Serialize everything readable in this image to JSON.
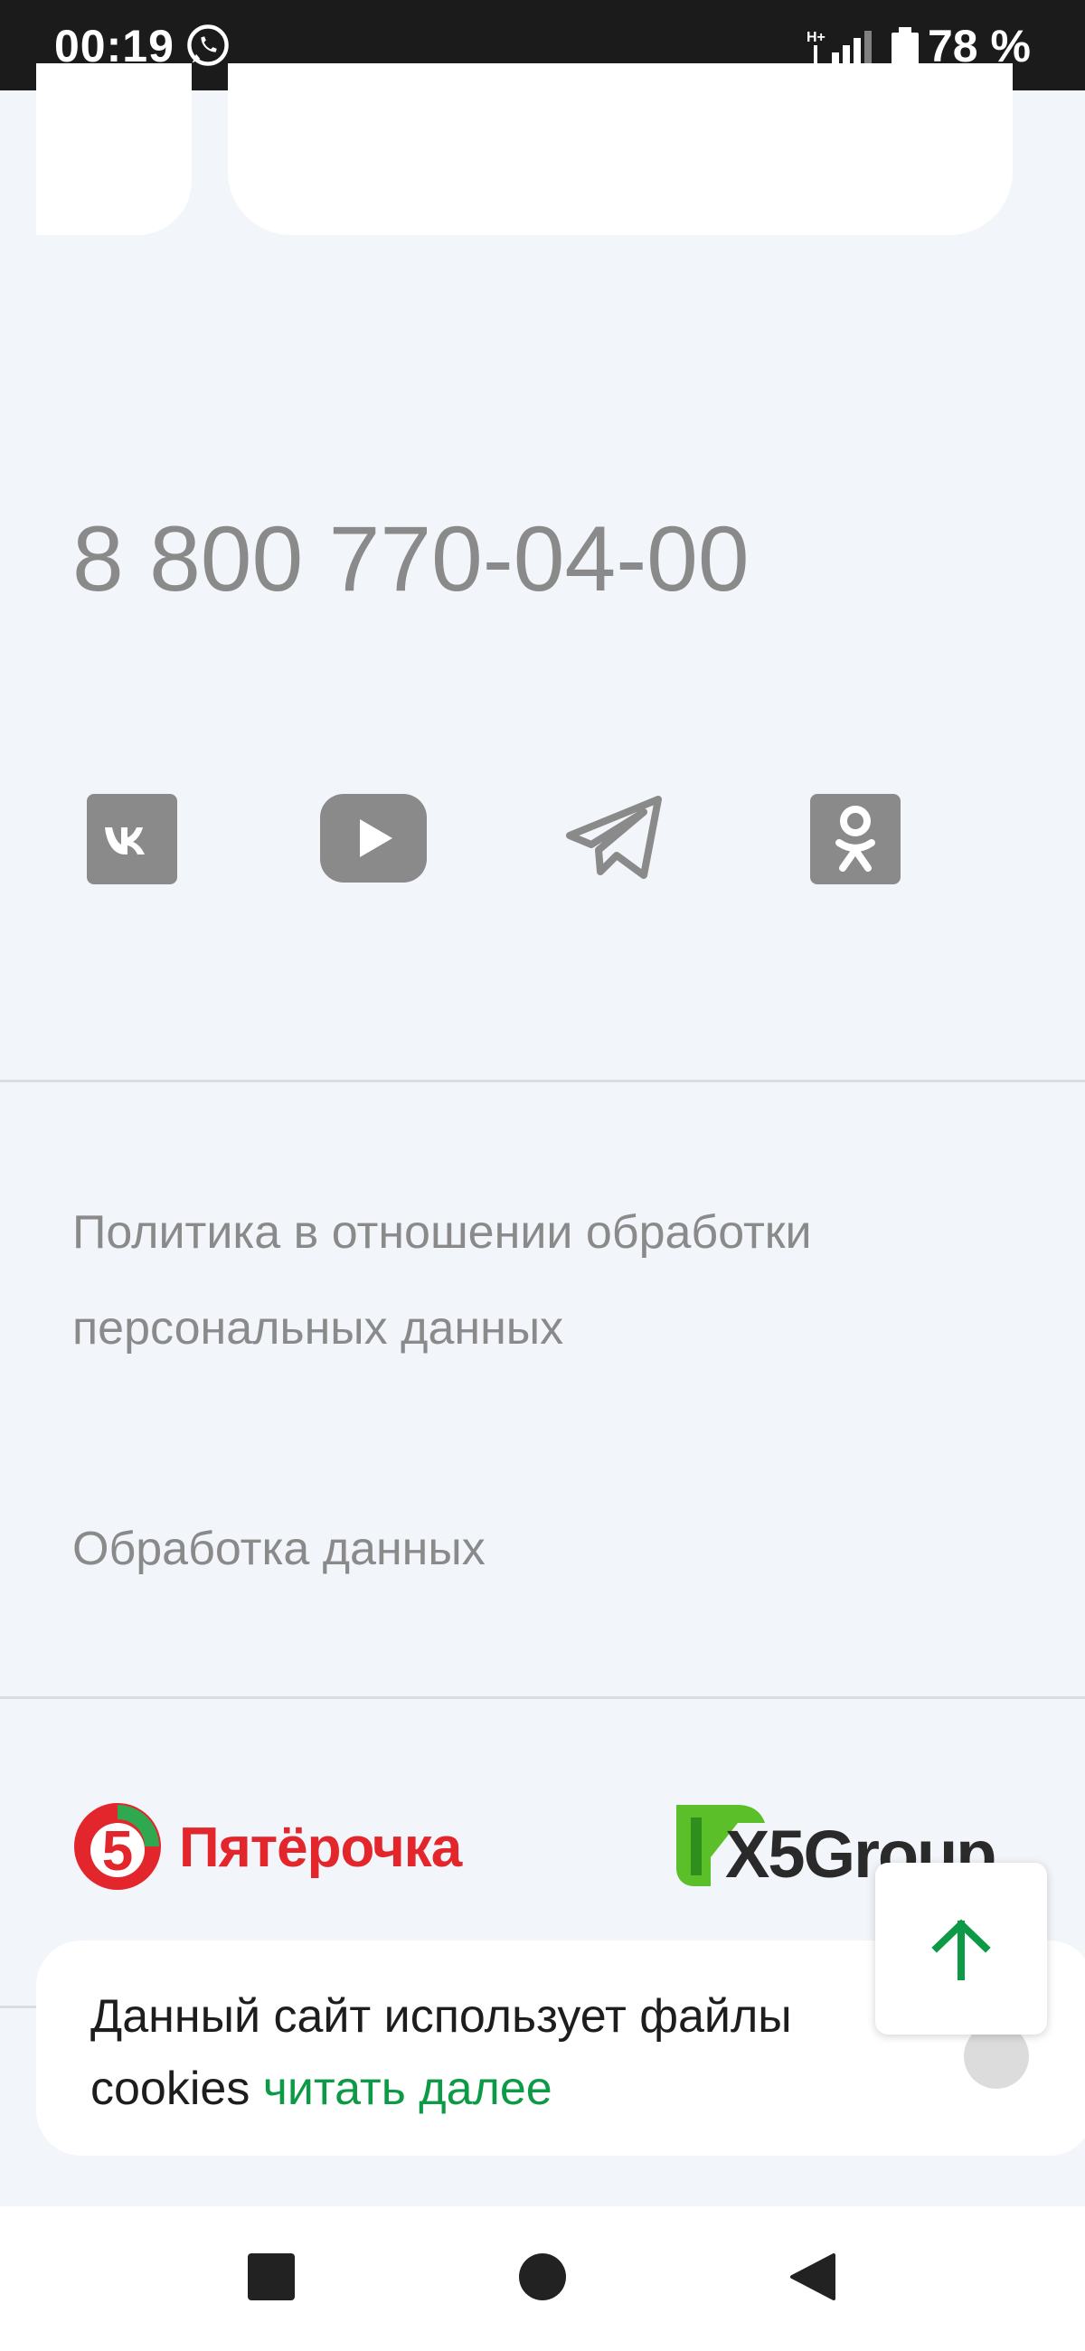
{
  "status_bar": {
    "time": "00:19",
    "battery": "78 %",
    "icons": [
      "whatsapp-icon",
      "network-icon",
      "battery-icon"
    ]
  },
  "contacts": {
    "phone": "8 800 770-04-00"
  },
  "social": [
    {
      "name": "vk-icon"
    },
    {
      "name": "youtube-icon"
    },
    {
      "name": "telegram-icon"
    },
    {
      "name": "odnoklassniki-icon"
    }
  ],
  "footer_links": {
    "policy": "Политика в отношении обработки персональных данных",
    "processing": "Обработка данных"
  },
  "logos": {
    "pyaterochka_digit": "5",
    "pyaterochka": "Пятёрочка",
    "x5group": "X5Group"
  },
  "cookie_banner": {
    "text": "Данный сайт использует файлы cookies",
    "link": "читать далее"
  },
  "colors": {
    "background": "#f2f5fa",
    "accent_green": "#0d9a46",
    "brand_red": "#e2262c",
    "icon_gray": "#8a8a8a"
  }
}
